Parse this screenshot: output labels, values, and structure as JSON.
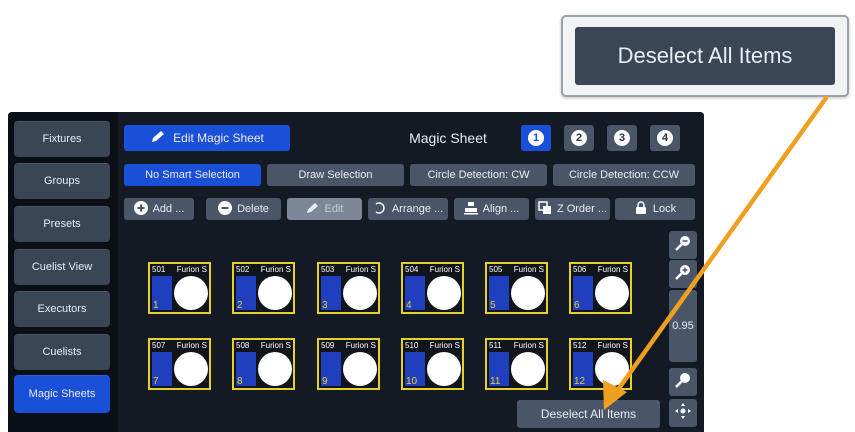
{
  "sidebar": {
    "items": [
      {
        "label": "Fixtures"
      },
      {
        "label": "Groups"
      },
      {
        "label": "Presets"
      },
      {
        "label": "Cuelist View"
      },
      {
        "label": "Executors"
      },
      {
        "label": "Cuelists"
      },
      {
        "label": "Magic Sheets",
        "active": true
      }
    ]
  },
  "header": {
    "edit_label": "Edit Magic Sheet",
    "title": "Magic Sheet",
    "pages": [
      "1",
      "2",
      "3",
      "4"
    ],
    "active_page": "1"
  },
  "selection_modes": {
    "no_smart": "No Smart Selection",
    "draw": "Draw Selection",
    "circle_cw": "Circle Detection: CW",
    "circle_ccw": "Circle Detection: CCW"
  },
  "toolbar": {
    "add": "Add ...",
    "delete": "Delete",
    "edit": "Edit",
    "arrange": "Arrange ...",
    "align": "Align ...",
    "zorder": "Z Order ...",
    "lock": "Lock"
  },
  "fixtures": [
    {
      "channel": "501",
      "type": "Furion S",
      "num": "1"
    },
    {
      "channel": "502",
      "type": "Furion S",
      "num": "2"
    },
    {
      "channel": "503",
      "type": "Furion S",
      "num": "3"
    },
    {
      "channel": "504",
      "type": "Furion S",
      "num": "4"
    },
    {
      "channel": "505",
      "type": "Furion S",
      "num": "5"
    },
    {
      "channel": "506",
      "type": "Furion S",
      "num": "6"
    },
    {
      "channel": "507",
      "type": "Furion S",
      "num": "7"
    },
    {
      "channel": "508",
      "type": "Furion S",
      "num": "8"
    },
    {
      "channel": "509",
      "type": "Furion S",
      "num": "9"
    },
    {
      "channel": "510",
      "type": "Furion S",
      "num": "10"
    },
    {
      "channel": "511",
      "type": "Furion S",
      "num": "11"
    },
    {
      "channel": "512",
      "type": "Furion S",
      "num": "12"
    }
  ],
  "zoom": {
    "value": "0.95"
  },
  "deselect_label": "Deselect All Items",
  "callout": {
    "label": "Deselect All Items"
  },
  "colors": {
    "accent": "#1a4fd8",
    "fixture_border": "#e6d12a",
    "arrow": "#f0a020"
  }
}
